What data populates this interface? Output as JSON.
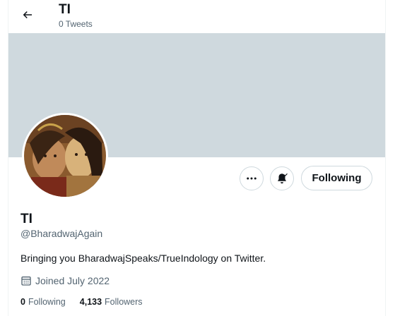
{
  "header": {
    "title": "TI",
    "tweets_count": "0 Tweets"
  },
  "profile": {
    "name": "TI",
    "handle": "@BharadwajAgain",
    "bio": "Bringing you BharadwajSpeaks/TrueIndology on Twitter.",
    "joined": "Joined July 2022",
    "following_count": "0",
    "following_label": "Following",
    "followers_count": "4,133",
    "followers_label": "Followers"
  },
  "actions": {
    "follow_label": "Following"
  },
  "icons": {
    "back": "back-arrow-icon",
    "more": "more-icon",
    "notifications": "bell-check-icon",
    "calendar": "calendar-icon"
  },
  "colors": {
    "banner": "#cfd9de",
    "secondary_text": "#536471",
    "primary_text": "#0f1419",
    "border": "#cfd9de"
  }
}
